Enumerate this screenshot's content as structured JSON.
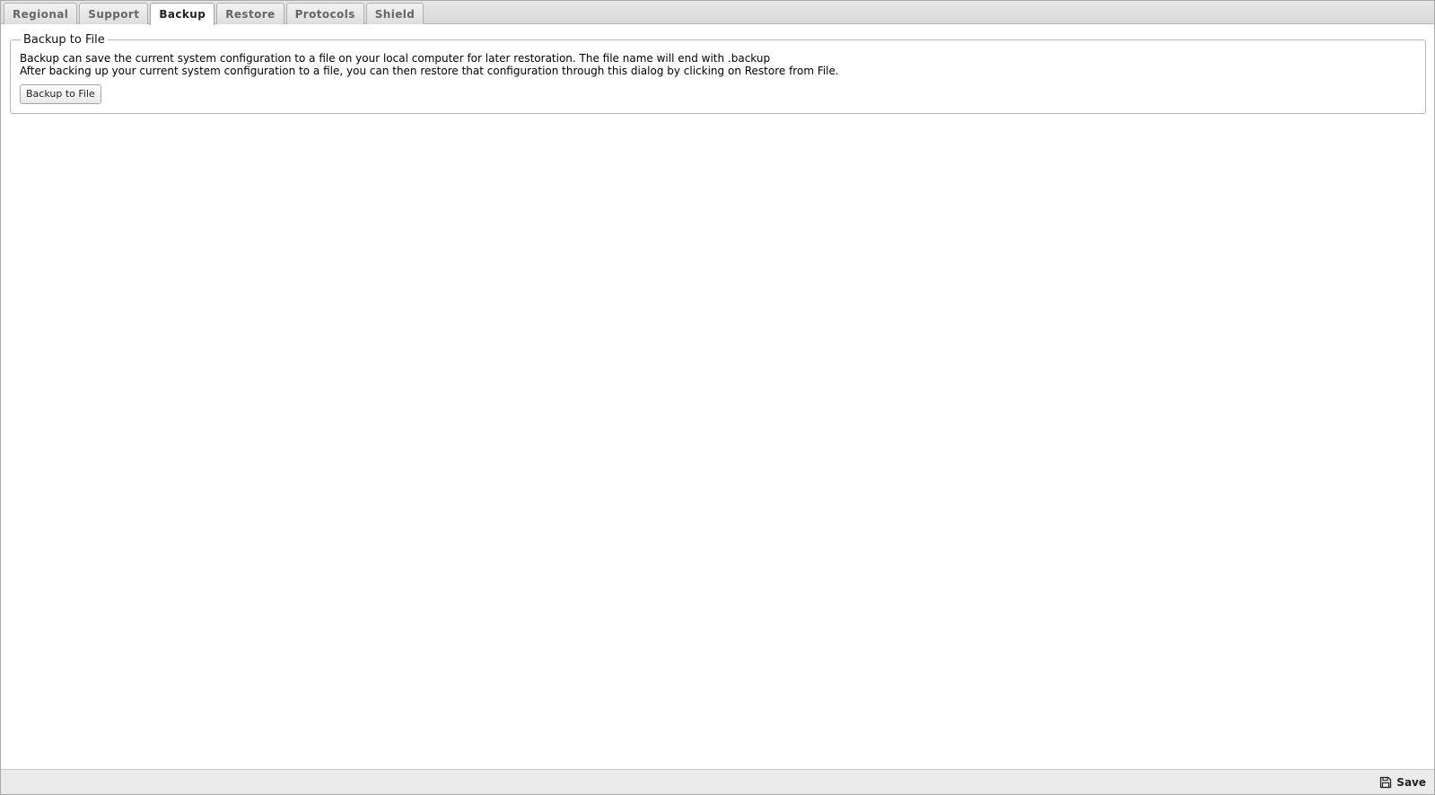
{
  "tabs": [
    {
      "label": "Regional",
      "active": false
    },
    {
      "label": "Support",
      "active": false
    },
    {
      "label": "Backup",
      "active": true
    },
    {
      "label": "Restore",
      "active": false
    },
    {
      "label": "Protocols",
      "active": false
    },
    {
      "label": "Shield",
      "active": false
    }
  ],
  "backup": {
    "legend": "Backup to File",
    "line1": "Backup can save the current system configuration to a file on your local computer for later restoration. The file name will end with .backup",
    "line2": "After backing up your current system configuration to a file, you can then restore that configuration through this dialog by clicking on Restore from File.",
    "button_label": "Backup to File"
  },
  "footer": {
    "save_label": "Save",
    "save_icon": "floppy-disk-icon"
  }
}
